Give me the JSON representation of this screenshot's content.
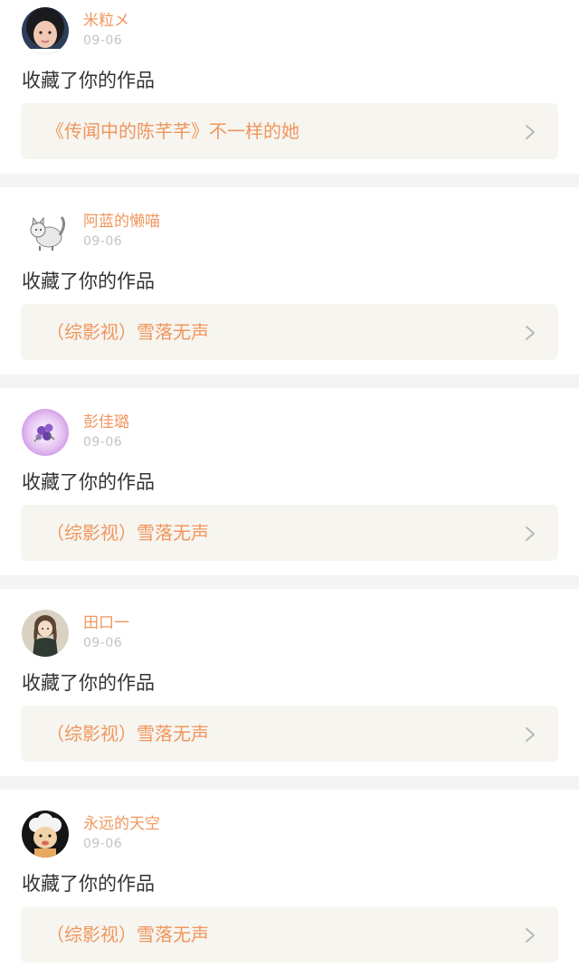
{
  "feed": [
    {
      "username": "米粒メ",
      "date": "09-06",
      "action": "收藏了你的作品",
      "work_title": "《传闻中的陈芊芊》不一样的她",
      "avatar_icon": "girl-portrait-avatar-icon"
    },
    {
      "username": "阿蓝的懒喵",
      "date": "09-06",
      "action": "收藏了你的作品",
      "work_title": "（综影视）雪落无声",
      "avatar_icon": "cat-sketch-avatar-icon"
    },
    {
      "username": "彭佳璐",
      "date": "09-06",
      "action": "收藏了你的作品",
      "work_title": "（综影视）雪落无声",
      "avatar_icon": "purple-flowers-avatar-icon"
    },
    {
      "username": "田口一",
      "date": "09-06",
      "action": "收藏了你的作品",
      "work_title": "（综影视）雪落无声",
      "avatar_icon": "anime-girl-avatar-icon"
    },
    {
      "username": "永远的天空",
      "date": "09-06",
      "action": "收藏了你的作品",
      "work_title": "（综影视）雪落无声",
      "avatar_icon": "cartoon-sheep-avatar-icon"
    }
  ],
  "colors": {
    "accent": "#f0965e",
    "link_background": "#f6f5ef",
    "divider": "#f4f4f4",
    "date_text": "#c3c3c3",
    "body_text": "#333333"
  }
}
